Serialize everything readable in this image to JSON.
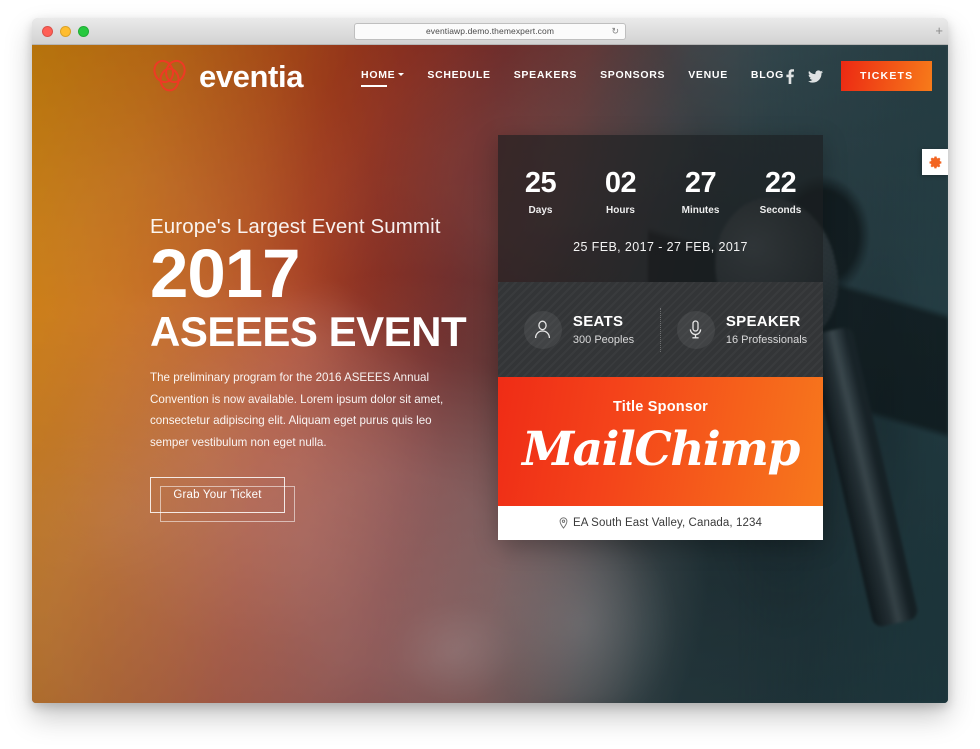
{
  "browser": {
    "url": "eventiawp.demo.themexpert.com",
    "reload_icon": "reload-icon",
    "new_tab_icon": "plus-icon",
    "traffic_lights": [
      "close",
      "minimize",
      "maximize"
    ]
  },
  "header": {
    "logo_text": "eventia",
    "logo_icon": "eventia-petals-logo",
    "nav": [
      {
        "label": "HOME",
        "active": true,
        "has_dropdown": true
      },
      {
        "label": "SCHEDULE",
        "active": false,
        "has_dropdown": false
      },
      {
        "label": "SPEAKERS",
        "active": false,
        "has_dropdown": false
      },
      {
        "label": "SPONSORS",
        "active": false,
        "has_dropdown": false
      },
      {
        "label": "VENUE",
        "active": false,
        "has_dropdown": false
      },
      {
        "label": "BLOG",
        "active": false,
        "has_dropdown": false
      }
    ],
    "social": [
      {
        "name": "facebook-icon"
      },
      {
        "name": "twitter-icon"
      }
    ],
    "tickets_label": "TICKETS",
    "tickets_gradient_from": "#ec2913",
    "tickets_gradient_to": "#f77b1a"
  },
  "hero": {
    "kicker": "Europe's Largest Event Summit",
    "year": "2017",
    "title": "ASEEES EVENT",
    "description": "The preliminary program for the 2016 ASEEES Annual Convention is now available. Lorem ipsum dolor sit amet, consectetur adipiscing elit. Aliquam eget purus quis leo semper vestibulum non eget nulla.",
    "cta_label": "Grab Your Ticket"
  },
  "countdown": {
    "units": [
      {
        "value": "25",
        "label": "Days"
      },
      {
        "value": "02",
        "label": "Hours"
      },
      {
        "value": "27",
        "label": "Minutes"
      },
      {
        "value": "22",
        "label": "Seconds"
      }
    ],
    "dates": "25 FEB, 2017 - 27 FEB, 2017"
  },
  "stats": [
    {
      "icon": "person-icon",
      "title": "SEATS",
      "subtitle": "300 Peoples"
    },
    {
      "icon": "microphone-icon",
      "title": "SPEAKER",
      "subtitle": "16 Professionals"
    }
  ],
  "sponsor": {
    "label": "Title Sponsor",
    "name": "MailChimp",
    "gradient_from": "#ef2c16",
    "gradient_to": "#f7781c"
  },
  "address": {
    "icon": "location-pin-icon",
    "text": "EA South East Valley, Canada, 1234"
  },
  "settings_tab": {
    "icon": "gear-icon",
    "color": "#f26522"
  }
}
